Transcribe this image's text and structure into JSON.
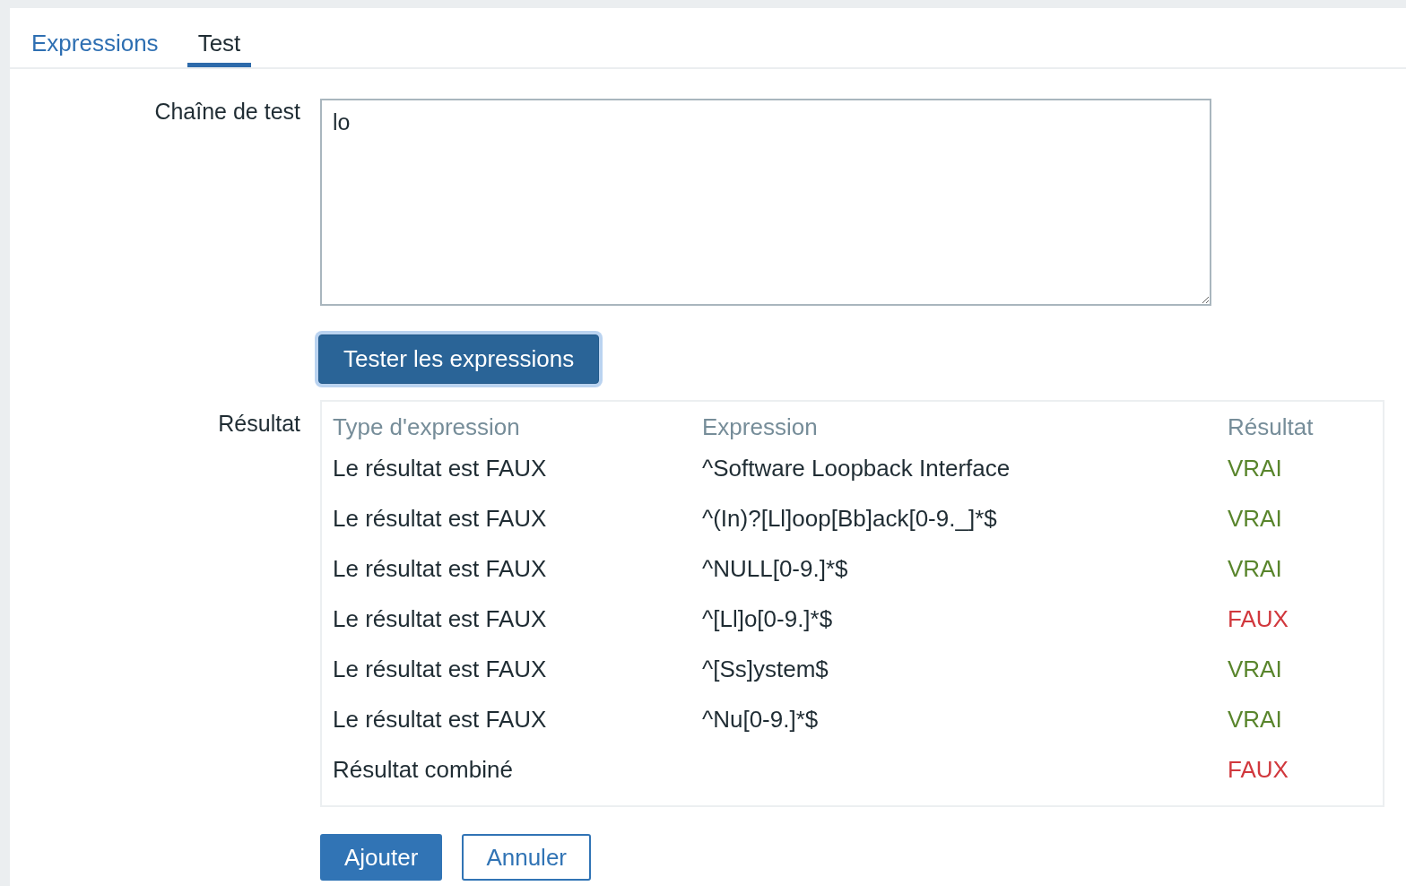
{
  "tabs": [
    {
      "label": "Expressions",
      "selected": false
    },
    {
      "label": "Test",
      "selected": true
    }
  ],
  "test_string": {
    "label": "Chaîne de test",
    "value": "lo"
  },
  "test_button": {
    "label": "Tester les expressions",
    "focused": true
  },
  "result": {
    "label": "Résultat",
    "columns": [
      "Type d'expression",
      "Expression",
      "Résultat"
    ],
    "rows": [
      {
        "type": "Le résultat est FAUX",
        "expression": "^Software Loopback Interface",
        "result": "VRAI",
        "color": "#59852c"
      },
      {
        "type": "Le résultat est FAUX",
        "expression": "^(In)?[Ll]oop[Bb]ack[0-9._]*$",
        "result": "VRAI",
        "color": "#59852c"
      },
      {
        "type": "Le résultat est FAUX",
        "expression": "^NULL[0-9.]*$",
        "result": "VRAI",
        "color": "#59852c"
      },
      {
        "type": "Le résultat est FAUX",
        "expression": "^[Ll]o[0-9.]*$",
        "result": "FAUX",
        "color": "#d1383d"
      },
      {
        "type": "Le résultat est FAUX",
        "expression": "^[Ss]ystem$",
        "result": "VRAI",
        "color": "#59852c"
      },
      {
        "type": "Le résultat est FAUX",
        "expression": "^Nu[0-9.]*$",
        "result": "VRAI",
        "color": "#59852c"
      },
      {
        "type": "Résultat combiné",
        "result": "FAUX",
        "color": "#d1383d"
      }
    ]
  },
  "buttons": [
    {
      "label": "Ajouter",
      "kind": "primary"
    },
    {
      "label": "Annuler",
      "kind": "secondary"
    }
  ]
}
